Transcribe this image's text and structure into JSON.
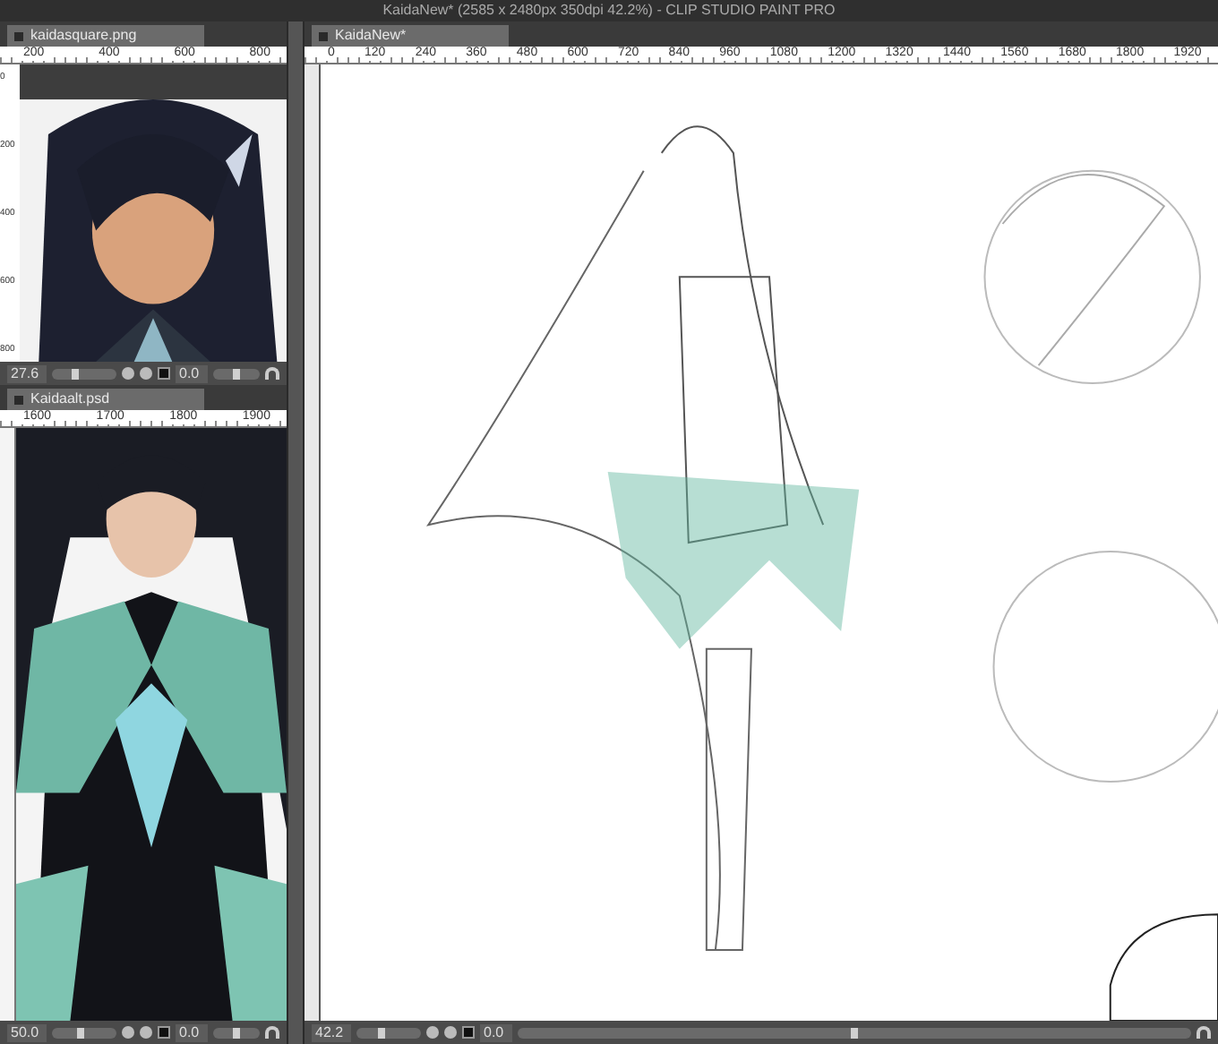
{
  "title_bar": {
    "title": "KaidaNew*  (2585 x 2480px 350dpi 42.2%) - CLIP STUDIO PAINT PRO"
  },
  "documents": [
    {
      "tab": "kaidasquare.png",
      "ruler_ticks": [
        "200",
        "400",
        "600",
        "800"
      ],
      "side_ticks": [
        "0",
        "200",
        "400",
        "600",
        "800"
      ],
      "zoom": "27.6",
      "zoom_slider": {
        "level": 0.35
      },
      "angle": "0.0",
      "rotate_slider": {
        "level": 0.5
      }
    },
    {
      "tab": "Kaidaalt.psd",
      "ruler_ticks": [
        "1600",
        "1700",
        "1800",
        "1900"
      ],
      "zoom": "50.0",
      "zoom_slider": {
        "level": 0.45
      },
      "angle": "0.0",
      "rotate_slider": {
        "level": 0.5
      }
    }
  ],
  "canvas": {
    "tab": "KaidaNew*",
    "ruler_ticks": [
      "0",
      "120",
      "240",
      "360",
      "480",
      "600",
      "720",
      "840",
      "960",
      "1080",
      "1200",
      "1320",
      "1440",
      "1560",
      "1680",
      "1800",
      "1920"
    ],
    "zoom": "42.2",
    "zoom_slider": {
      "level": 0.4
    },
    "angle": "0.0",
    "rotate_slider": {
      "level": 0.5
    }
  }
}
